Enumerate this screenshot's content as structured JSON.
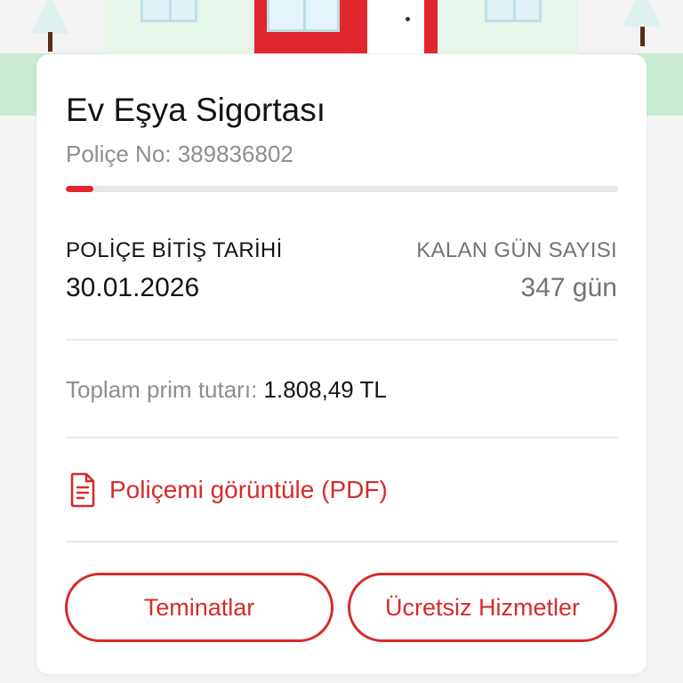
{
  "card": {
    "title": "Ev Eşya Sigortası",
    "policy_no": "Poliçe No: 389836802",
    "progress_fraction": 0.05,
    "end_date_label": "POLİÇE BİTİŞ TARİHİ",
    "end_date_value": "30.01.2026",
    "remaining_label": "KALAN GÜN SAYISI",
    "remaining_value": "347 gün",
    "premium_label": "Toplam prim tutarı:",
    "premium_value": "1.808,49 TL",
    "pdf_link": "Poliçemi görüntüle (PDF)",
    "pdf_icon": "document-icon",
    "buttons": {
      "coverages": "Teminatlar",
      "free_services": "Ücretsiz Hizmetler"
    }
  },
  "colors": {
    "accent": "#d62b2b",
    "progress_track": "#e6e6e6",
    "card_bg": "#ffffff",
    "page_bg": "#f3f3f3"
  }
}
